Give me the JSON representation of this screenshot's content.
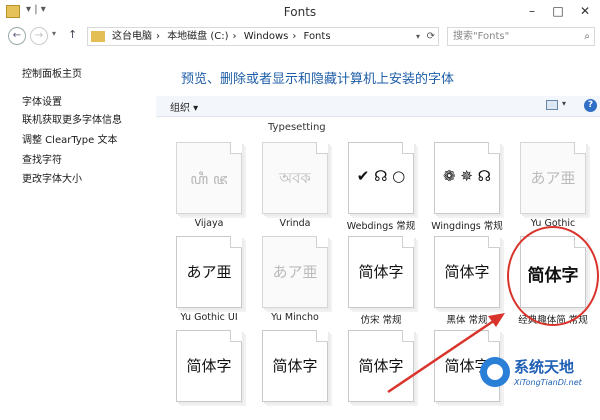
{
  "window": {
    "title": "Fonts",
    "quick_access": "▾ | ▾",
    "minimize": "–",
    "maximize": "□",
    "close": "✕"
  },
  "address": {
    "back": "←",
    "forward": "→",
    "history_dropdown": "▾",
    "up": "↑",
    "crumbs": [
      "这台电脑",
      "本地磁盘 (C:)",
      "Windows",
      "Fonts"
    ],
    "separators": [
      "›",
      "›",
      "›"
    ],
    "dropdown": "▾",
    "refresh": "⟳"
  },
  "search": {
    "placeholder": "搜索\"Fonts\"",
    "icon": "⌕"
  },
  "sidebar": {
    "links": [
      "控制面板主页",
      "字体设置",
      "联机获取更多字体信息",
      "调整 ClearType 文本",
      "查找字符",
      "更改字体大小"
    ]
  },
  "main": {
    "heading": "预览、删除或者显示和隐藏计算机上安装的字体",
    "organize": "组织 ▾",
    "view_dropdown": "▾",
    "help": "?",
    "partial_label": "Typesetting"
  },
  "fonts": [
    {
      "name": "Vijaya",
      "sample": "ꦲꦶ ꦗ",
      "dark": false
    },
    {
      "name": "Vrinda",
      "sample": "অবক",
      "dark": false
    },
    {
      "name": "Webdings 常规",
      "sample": "✔ ☊ ○",
      "dark": true
    },
    {
      "name": "Wingdings 常规",
      "sample": "❁ ✵ ☊",
      "dark": true
    },
    {
      "name": "Yu Gothic",
      "sample": "あア亜",
      "dark": false
    },
    {
      "name": "Yu Gothic UI",
      "sample": "あア亜",
      "dark": true
    },
    {
      "name": "Yu Mincho",
      "sample": "あア亜",
      "dark": false
    },
    {
      "name": "仿宋 常规",
      "sample": "简体字",
      "dark": true
    },
    {
      "name": "黑体 常规",
      "sample": "简体字",
      "dark": true
    },
    {
      "name": "经典趣体简 常规",
      "sample": "简体字",
      "dark": true
    },
    {
      "name": "",
      "sample": "简体字",
      "dark": true
    },
    {
      "name": "",
      "sample": "简体字",
      "dark": true
    },
    {
      "name": "",
      "sample": "简体字",
      "dark": true
    },
    {
      "name": "",
      "sample": "简体字",
      "dark": true
    }
  ],
  "watermark": {
    "title": "系统天地",
    "url": "XiTongTianDi.net"
  },
  "colors": {
    "heading": "#1f5ea8",
    "highlight_circle": "#d9342b",
    "watermark": "#1f5fb5"
  }
}
